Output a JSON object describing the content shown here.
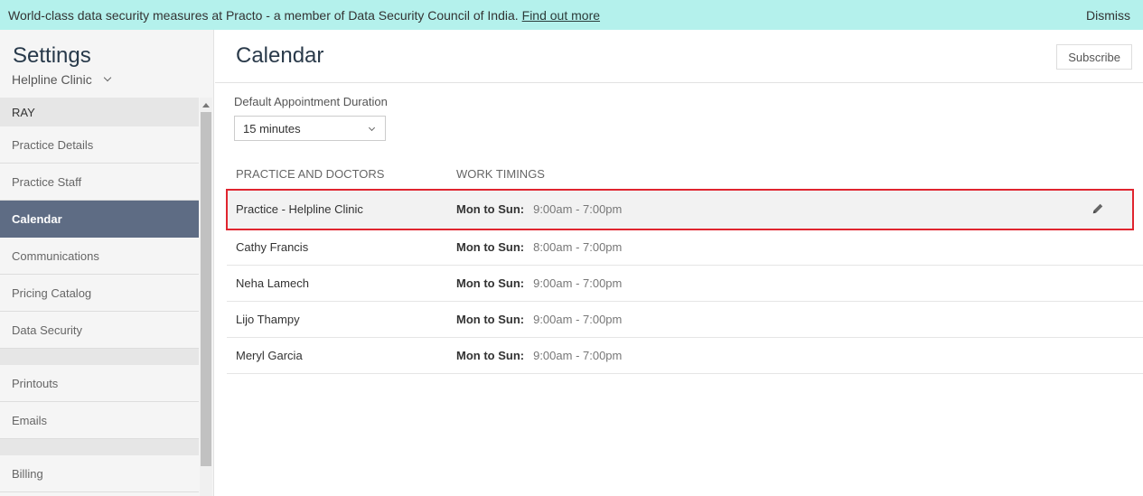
{
  "banner": {
    "message": "World-class data security measures at Practo - a member of Data Security Council of India.",
    "link": "Find out more",
    "dismiss": "Dismiss"
  },
  "sidebar": {
    "title": "Settings",
    "clinic": "Helpline Clinic",
    "section1": "RAY",
    "items": [
      {
        "label": "Practice Details"
      },
      {
        "label": "Practice Staff"
      },
      {
        "label": "Calendar"
      },
      {
        "label": "Communications"
      },
      {
        "label": "Pricing Catalog"
      },
      {
        "label": "Data Security"
      },
      {
        "label": "Printouts"
      },
      {
        "label": "Emails"
      },
      {
        "label": "Billing"
      }
    ]
  },
  "main": {
    "title": "Calendar",
    "subscribe": "Subscribe",
    "duration_label": "Default Appointment Duration",
    "duration_value": "15 minutes",
    "columns": [
      "PRACTICE AND DOCTORS",
      "WORK TIMINGS"
    ],
    "rows": [
      {
        "name": "Practice - Helpline Clinic",
        "days": "Mon to Sun:",
        "time": "9:00am - 7:00pm"
      },
      {
        "name": "Cathy Francis",
        "days": "Mon to Sun:",
        "time": "8:00am - 7:00pm"
      },
      {
        "name": "Neha Lamech",
        "days": "Mon to Sun:",
        "time": "9:00am - 7:00pm"
      },
      {
        "name": "Lijo Thampy",
        "days": "Mon to Sun:",
        "time": "9:00am - 7:00pm"
      },
      {
        "name": "Meryl Garcia",
        "days": "Mon to Sun:",
        "time": "9:00am - 7:00pm"
      }
    ]
  }
}
